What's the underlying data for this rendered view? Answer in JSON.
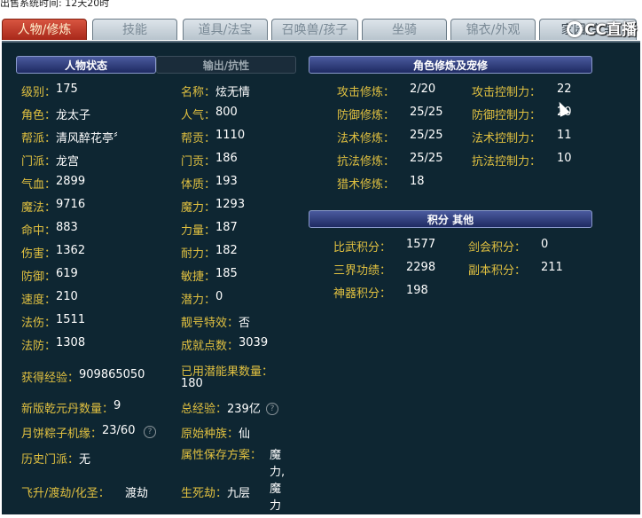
{
  "top_text": "出售系统时间: 12天20时",
  "tabs": [
    {
      "label": "人物/修炼",
      "active": true
    },
    {
      "label": "技能",
      "active": false
    },
    {
      "label": "道具/法宝",
      "active": false
    },
    {
      "label": "召唤兽/孩子",
      "active": false
    },
    {
      "label": "坐骑",
      "active": false
    },
    {
      "label": "锦衣/外观",
      "active": false
    },
    {
      "label": "家园/宝宝",
      "active": false
    }
  ],
  "logo_text": "CC直播",
  "left_tabs": {
    "status": "人物状态",
    "resist": "输出/抗性"
  },
  "stats": [
    {
      "l": "级别：",
      "v": "175"
    },
    {
      "l": "名称：",
      "v": "炫无情"
    },
    {
      "l": "角色：",
      "v": "龙太子"
    },
    {
      "l": "人气：",
      "v": "800"
    },
    {
      "l": "帮派：",
      "v": "清风醉花亭〞"
    },
    {
      "l": "帮贡：",
      "v": "1110"
    },
    {
      "l": "门派：",
      "v": "龙宫"
    },
    {
      "l": "门贡：",
      "v": "186"
    },
    {
      "l": "气血：",
      "v": "2899"
    },
    {
      "l": "体质：",
      "v": "193"
    },
    {
      "l": "魔法：",
      "v": "9716"
    },
    {
      "l": "魔力：",
      "v": "1293"
    },
    {
      "l": "命中：",
      "v": "883"
    },
    {
      "l": "力量：",
      "v": "187"
    },
    {
      "l": "伤害：",
      "v": "1362"
    },
    {
      "l": "耐力：",
      "v": "182"
    },
    {
      "l": "防御：",
      "v": "619"
    },
    {
      "l": "敏捷：",
      "v": "185"
    },
    {
      "l": "速度：",
      "v": "210"
    },
    {
      "l": "潜力：",
      "v": "0"
    },
    {
      "l": "法伤：",
      "v": "1511"
    },
    {
      "l": "靓号特效：",
      "v": "否"
    },
    {
      "l": "法防：",
      "v": "1308"
    },
    {
      "l": "成就点数：",
      "v": "3039"
    },
    {
      "l": "获得经验：",
      "v": "909865050"
    },
    {
      "l": "已用潜能果数量：",
      "v": "180"
    },
    {
      "l": "新版乾元丹数量：",
      "v": "9"
    },
    {
      "l": "总经验：",
      "v": "239亿"
    },
    {
      "l": "月饼粽子机缘：",
      "v": "23/60"
    },
    {
      "l": "原始种族：",
      "v": "仙"
    },
    {
      "l": "历史门派：",
      "v": "无"
    },
    {
      "l": "属性保存方案：",
      "v": "魔力,魔力"
    },
    {
      "l": "飞升/渡劫/化圣：",
      "v": "渡劫"
    },
    {
      "l": "生死劫：",
      "v": "九层"
    }
  ],
  "cultivation": {
    "header": "角色修炼及宠修",
    "items": [
      {
        "l": "攻击修炼：",
        "v": "2/20"
      },
      {
        "l": "攻击控制力：",
        "v": "22"
      },
      {
        "l": "防御修炼：",
        "v": "25/25"
      },
      {
        "l": "防御控制力：",
        "v": "20"
      },
      {
        "l": "法术修炼：",
        "v": "25/25"
      },
      {
        "l": "法术控制力：",
        "v": "11"
      },
      {
        "l": "抗法修炼：",
        "v": "25/25"
      },
      {
        "l": "抗法控制力：",
        "v": "10"
      },
      {
        "l": "猎术修炼：",
        "v": "18"
      }
    ]
  },
  "scores": {
    "header": "积分 其他",
    "items": [
      {
        "l": "比武积分：",
        "v": "1577"
      },
      {
        "l": "剑会积分：",
        "v": "0"
      },
      {
        "l": "三界功绩：",
        "v": "2298"
      },
      {
        "l": "副本积分：",
        "v": "211"
      },
      {
        "l": "神器积分：",
        "v": "198"
      }
    ]
  },
  "help_icon": "?"
}
